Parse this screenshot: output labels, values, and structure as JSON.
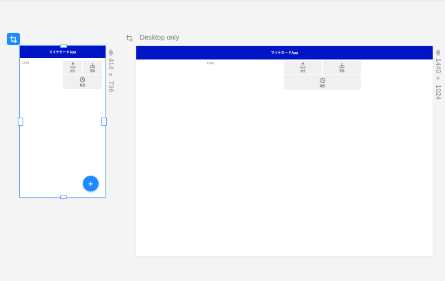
{
  "canvas": {
    "desktop_artboard_title": "Desktop only",
    "mobile_size_label": "414 × 736",
    "desktop_size_label": "1440 × 1024"
  },
  "app": {
    "title": "マイナカードApp",
    "number_text": "1234",
    "buttons": [
      {
        "label": "送金",
        "icon": "upload-icon"
      },
      {
        "label": "受取",
        "icon": "download-icon"
      },
      {
        "label": "履歴",
        "icon": "clock-icon"
      }
    ],
    "fab_symbol": "+"
  },
  "colors": {
    "app_bar": "#0015c6",
    "accent": "#1a8cff",
    "canvas": "#f4f4f4"
  }
}
